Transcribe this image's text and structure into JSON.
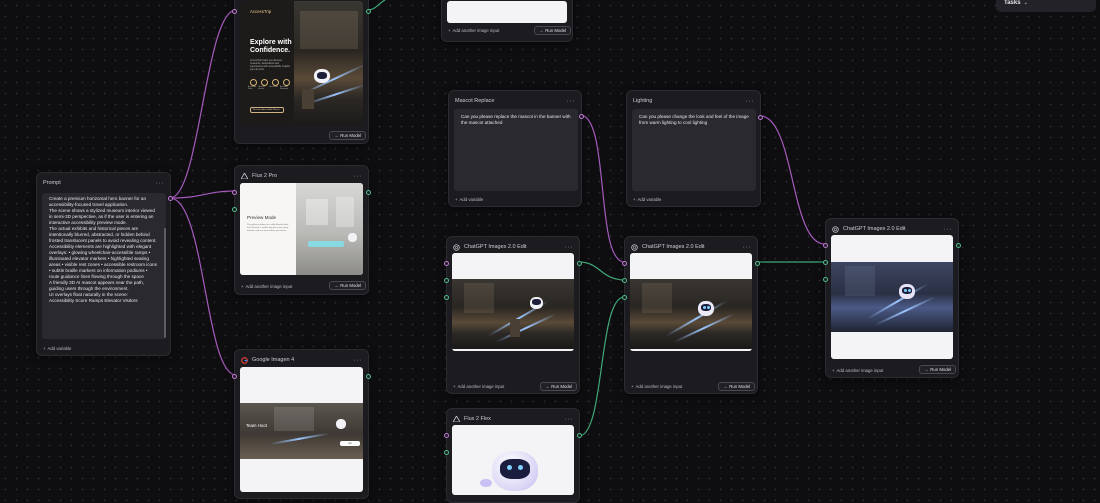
{
  "tasks": {
    "label": "Tasks",
    "chevron": "chevron-down-icon"
  },
  "common": {
    "run_label": "Run Model",
    "add_image_label": "Add another image input",
    "add_variable_label": "Add variable",
    "menu_glyph": "···"
  },
  "nodes": {
    "prompt": {
      "title": "Prompt",
      "text": "Create a premium horizontal hero banner for an accessibility-focused travel application.\nThe scene shows a stylized museum interior viewed in semi-3D perspective, as if the user is entering an interactive accessibility preview mode.\nThe actual exhibits and historical pieces are intentionally blurred, abstracted, or hidden behind frosted translucent panels to avoid revealing content.\nAccessibility elements are highlighted with elegant overlays: • glowing wheelchair-accessible ramps • illuminated elevator markers • highlighted seating areas • visible rest zones • accessible restroom icons • subtle braille markers on information podiums • route guidance lines flowing through the space\nA friendly 3D AI mascot appears near the path, guiding users through the environment.\nUI overlays float naturally in the scene:\nAccessibility Score  Ramps  Elevator  Visitors"
    },
    "top_image": {
      "brand": "AccessTrip",
      "headline_line1": "Explore with",
      "headline_line2": "Confidence.",
      "body": "AccessTrip helps you discover museums, destinations and experiences with accessibility insights you can trust.",
      "features": [
        "Accessible Paths",
        "Elevator Access",
        "Rest Zones",
        "Accessible Restrooms"
      ],
      "cta": "Discover Accessible Places"
    },
    "flux_pro": {
      "title": "Flux 2 Pro",
      "panel_title": "Preview Mode",
      "panel_text": "The gallery exhibits are softly blurred while the full route is visible. Explore every ramp, elevator and rest zone before you arrive."
    },
    "imagen": {
      "title": "Google Imagen 4",
      "overlay": "Team Hoot",
      "chip": "Go"
    },
    "mascot_replace": {
      "title": "Mascot Replace",
      "text": "Can you please replace the mascot in the banner with the mascot attached"
    },
    "lighting": {
      "title": "Lighting",
      "text": "Can you please change the look and feel of the image from warm lighting to cool lighting"
    },
    "gpt_edit_1": {
      "title": "ChatGPT Images 2.0 Edit"
    },
    "gpt_edit_2": {
      "title": "ChatGPT Images 2.0 Edit"
    },
    "gpt_edit_3": {
      "title": "ChatGPT Images 2.0 Edit"
    },
    "flux_flex": {
      "title": "Flux 2 Flex"
    }
  },
  "colors": {
    "port_purple": "#c37ad8",
    "port_green": "#4fbf8a",
    "wire_purple": "#b05fc9",
    "wire_green": "#3fa977",
    "node_bg": "#1c1b20"
  }
}
